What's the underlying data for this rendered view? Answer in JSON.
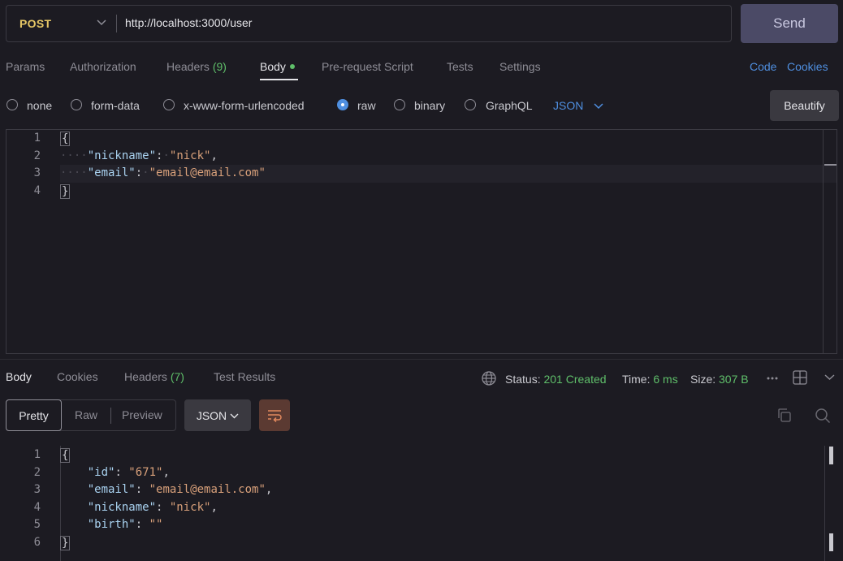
{
  "request": {
    "method": "POST",
    "url": "http://localhost:3000/user",
    "send_label": "Send"
  },
  "request_tabs": {
    "params": "Params",
    "authorization": "Authorization",
    "headers": "Headers",
    "headers_count": "(9)",
    "body": "Body",
    "pre_request": "Pre-request Script",
    "tests": "Tests",
    "settings": "Settings",
    "code": "Code",
    "cookies": "Cookies"
  },
  "body_types": {
    "none": "none",
    "form_data": "form-data",
    "urlencoded": "x-www-form-urlencoded",
    "raw": "raw",
    "binary": "binary",
    "graphql": "GraphQL",
    "selected": "raw",
    "language": "JSON",
    "beautify": "Beautify"
  },
  "request_body": {
    "line_numbers": [
      "1",
      "2",
      "3",
      "4"
    ],
    "open_brace": "{",
    "close_brace": "}",
    "fields": [
      {
        "key": "\"nickname\"",
        "value": "\"nick\"",
        "trail": ","
      },
      {
        "key": "\"email\"",
        "value": "\"email@email.com\"",
        "trail": ""
      }
    ]
  },
  "response_tabs": {
    "body": "Body",
    "cookies": "Cookies",
    "headers": "Headers",
    "headers_count": "(7)",
    "test_results": "Test Results"
  },
  "response_status": {
    "status_label": "Status:",
    "status_value": "201 Created",
    "time_label": "Time:",
    "time_value": "6 ms",
    "size_label": "Size:",
    "size_value": "307 B"
  },
  "response_view": {
    "pretty": "Pretty",
    "raw": "Raw",
    "preview": "Preview",
    "format": "JSON"
  },
  "response_body": {
    "line_numbers": [
      "1",
      "2",
      "3",
      "4",
      "5",
      "6"
    ],
    "open_brace": "{",
    "close_brace": "}",
    "fields": [
      {
        "key": "\"id\"",
        "value": "\"671\"",
        "trail": ","
      },
      {
        "key": "\"email\"",
        "value": "\"email@email.com\"",
        "trail": ","
      },
      {
        "key": "\"nickname\"",
        "value": "\"nick\"",
        "trail": ","
      },
      {
        "key": "\"birth\"",
        "value": "\"\"",
        "trail": ""
      }
    ]
  },
  "colors": {
    "background": "#1c1b22",
    "accent_blue": "#4f8fe0",
    "success_green": "#5fbf6a",
    "method_yellow": "#e6c766",
    "json_key": "#a9d2f0",
    "json_string": "#d8a07a"
  },
  "icons": [
    "chevron-down-icon",
    "globe-icon",
    "more-icon",
    "layout-icon",
    "copy-icon",
    "search-icon",
    "wrap-icon"
  ]
}
